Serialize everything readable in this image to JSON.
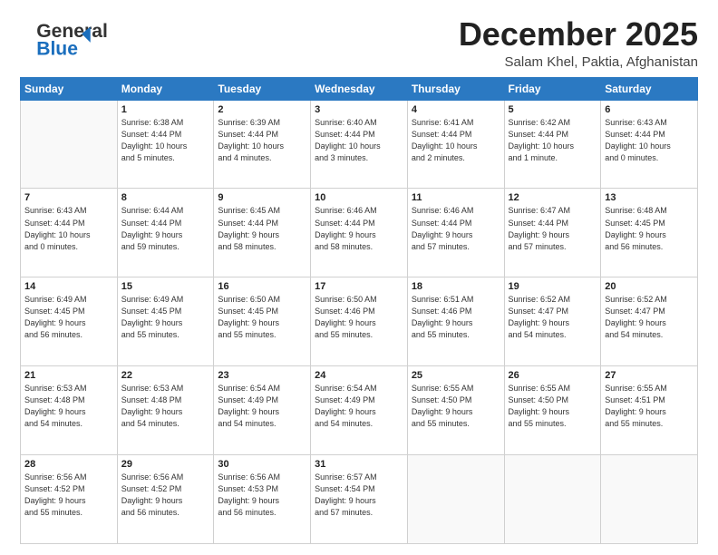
{
  "header": {
    "logo_line1": "General",
    "logo_line2": "Blue",
    "month": "December 2025",
    "location": "Salam Khel, Paktia, Afghanistan"
  },
  "days_of_week": [
    "Sunday",
    "Monday",
    "Tuesday",
    "Wednesday",
    "Thursday",
    "Friday",
    "Saturday"
  ],
  "weeks": [
    [
      {
        "day": "",
        "info": ""
      },
      {
        "day": "1",
        "info": "Sunrise: 6:38 AM\nSunset: 4:44 PM\nDaylight: 10 hours\nand 5 minutes."
      },
      {
        "day": "2",
        "info": "Sunrise: 6:39 AM\nSunset: 4:44 PM\nDaylight: 10 hours\nand 4 minutes."
      },
      {
        "day": "3",
        "info": "Sunrise: 6:40 AM\nSunset: 4:44 PM\nDaylight: 10 hours\nand 3 minutes."
      },
      {
        "day": "4",
        "info": "Sunrise: 6:41 AM\nSunset: 4:44 PM\nDaylight: 10 hours\nand 2 minutes."
      },
      {
        "day": "5",
        "info": "Sunrise: 6:42 AM\nSunset: 4:44 PM\nDaylight: 10 hours\nand 1 minute."
      },
      {
        "day": "6",
        "info": "Sunrise: 6:43 AM\nSunset: 4:44 PM\nDaylight: 10 hours\nand 0 minutes."
      }
    ],
    [
      {
        "day": "7",
        "info": "Sunrise: 6:43 AM\nSunset: 4:44 PM\nDaylight: 10 hours\nand 0 minutes."
      },
      {
        "day": "8",
        "info": "Sunrise: 6:44 AM\nSunset: 4:44 PM\nDaylight: 9 hours\nand 59 minutes."
      },
      {
        "day": "9",
        "info": "Sunrise: 6:45 AM\nSunset: 4:44 PM\nDaylight: 9 hours\nand 58 minutes."
      },
      {
        "day": "10",
        "info": "Sunrise: 6:46 AM\nSunset: 4:44 PM\nDaylight: 9 hours\nand 58 minutes."
      },
      {
        "day": "11",
        "info": "Sunrise: 6:46 AM\nSunset: 4:44 PM\nDaylight: 9 hours\nand 57 minutes."
      },
      {
        "day": "12",
        "info": "Sunrise: 6:47 AM\nSunset: 4:44 PM\nDaylight: 9 hours\nand 57 minutes."
      },
      {
        "day": "13",
        "info": "Sunrise: 6:48 AM\nSunset: 4:45 PM\nDaylight: 9 hours\nand 56 minutes."
      }
    ],
    [
      {
        "day": "14",
        "info": "Sunrise: 6:49 AM\nSunset: 4:45 PM\nDaylight: 9 hours\nand 56 minutes."
      },
      {
        "day": "15",
        "info": "Sunrise: 6:49 AM\nSunset: 4:45 PM\nDaylight: 9 hours\nand 55 minutes."
      },
      {
        "day": "16",
        "info": "Sunrise: 6:50 AM\nSunset: 4:45 PM\nDaylight: 9 hours\nand 55 minutes."
      },
      {
        "day": "17",
        "info": "Sunrise: 6:50 AM\nSunset: 4:46 PM\nDaylight: 9 hours\nand 55 minutes."
      },
      {
        "day": "18",
        "info": "Sunrise: 6:51 AM\nSunset: 4:46 PM\nDaylight: 9 hours\nand 55 minutes."
      },
      {
        "day": "19",
        "info": "Sunrise: 6:52 AM\nSunset: 4:47 PM\nDaylight: 9 hours\nand 54 minutes."
      },
      {
        "day": "20",
        "info": "Sunrise: 6:52 AM\nSunset: 4:47 PM\nDaylight: 9 hours\nand 54 minutes."
      }
    ],
    [
      {
        "day": "21",
        "info": "Sunrise: 6:53 AM\nSunset: 4:48 PM\nDaylight: 9 hours\nand 54 minutes."
      },
      {
        "day": "22",
        "info": "Sunrise: 6:53 AM\nSunset: 4:48 PM\nDaylight: 9 hours\nand 54 minutes."
      },
      {
        "day": "23",
        "info": "Sunrise: 6:54 AM\nSunset: 4:49 PM\nDaylight: 9 hours\nand 54 minutes."
      },
      {
        "day": "24",
        "info": "Sunrise: 6:54 AM\nSunset: 4:49 PM\nDaylight: 9 hours\nand 54 minutes."
      },
      {
        "day": "25",
        "info": "Sunrise: 6:55 AM\nSunset: 4:50 PM\nDaylight: 9 hours\nand 55 minutes."
      },
      {
        "day": "26",
        "info": "Sunrise: 6:55 AM\nSunset: 4:50 PM\nDaylight: 9 hours\nand 55 minutes."
      },
      {
        "day": "27",
        "info": "Sunrise: 6:55 AM\nSunset: 4:51 PM\nDaylight: 9 hours\nand 55 minutes."
      }
    ],
    [
      {
        "day": "28",
        "info": "Sunrise: 6:56 AM\nSunset: 4:52 PM\nDaylight: 9 hours\nand 55 minutes."
      },
      {
        "day": "29",
        "info": "Sunrise: 6:56 AM\nSunset: 4:52 PM\nDaylight: 9 hours\nand 56 minutes."
      },
      {
        "day": "30",
        "info": "Sunrise: 6:56 AM\nSunset: 4:53 PM\nDaylight: 9 hours\nand 56 minutes."
      },
      {
        "day": "31",
        "info": "Sunrise: 6:57 AM\nSunset: 4:54 PM\nDaylight: 9 hours\nand 57 minutes."
      },
      {
        "day": "",
        "info": ""
      },
      {
        "day": "",
        "info": ""
      },
      {
        "day": "",
        "info": ""
      }
    ]
  ]
}
